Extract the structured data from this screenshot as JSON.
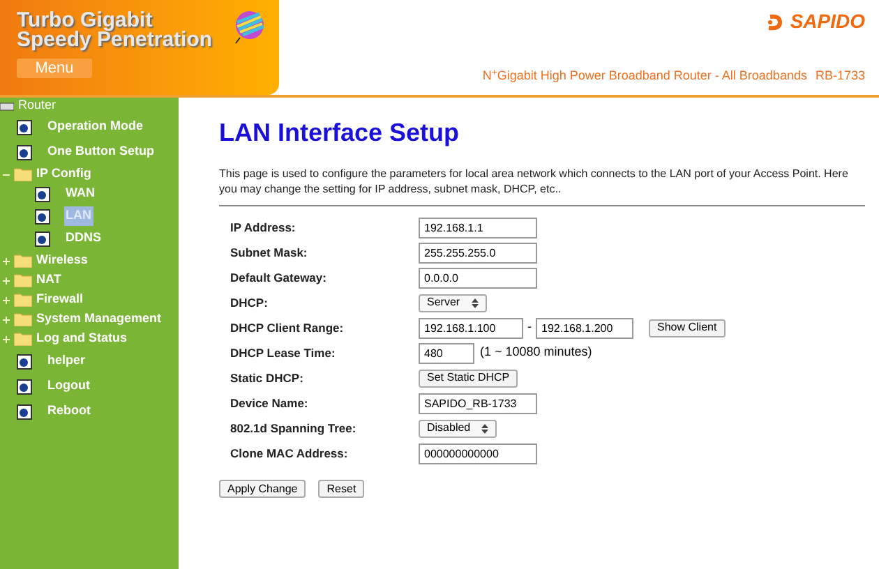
{
  "header": {
    "title_lines": [
      "Turbo Gigabit",
      "Speedy Penetration"
    ],
    "menu": "Menu",
    "brand": "SAPIDO",
    "tagline": {
      "sup": "+",
      "lead": "N",
      "text": "Gigabit High Power Broadband Router - All Broadbands",
      "model": "RB-1733"
    }
  },
  "sidebar": {
    "root": "Router",
    "items": [
      {
        "label": "Operation Mode",
        "kind": "page",
        "selected": false
      },
      {
        "label": "One Button Setup",
        "kind": "page",
        "selected": false
      },
      {
        "label": "IP Config",
        "kind": "folder",
        "expanded": true,
        "children": [
          {
            "label": "WAN",
            "kind": "page",
            "selected": false
          },
          {
            "label": "LAN",
            "kind": "page",
            "selected": true
          },
          {
            "label": "DDNS",
            "kind": "page",
            "selected": false
          }
        ]
      },
      {
        "label": "Wireless",
        "kind": "folder",
        "expanded": false
      },
      {
        "label": "NAT",
        "kind": "folder",
        "expanded": false
      },
      {
        "label": "Firewall",
        "kind": "folder",
        "expanded": false
      },
      {
        "label": "System Management",
        "kind": "folder",
        "expanded": false
      },
      {
        "label": "Log and Status",
        "kind": "folder",
        "expanded": false
      },
      {
        "label": "helper",
        "kind": "page",
        "selected": false
      },
      {
        "label": "Logout",
        "kind": "page",
        "selected": false
      },
      {
        "label": "Reboot",
        "kind": "page",
        "selected": false
      }
    ]
  },
  "page": {
    "title": "LAN Interface Setup",
    "description": "This page is used to configure the parameters for local area network which connects to the LAN port of your Access Point. Here you may change the setting for IP address, subnet mask, DHCP, etc..",
    "fields": [
      {
        "label": "IP Address:",
        "kind": "text",
        "value": "192.168.1.1"
      },
      {
        "label": "Subnet Mask:",
        "kind": "text",
        "value": "255.255.255.0"
      },
      {
        "label": "Default Gateway:",
        "kind": "text",
        "value": "0.0.0.0"
      },
      {
        "label": "DHCP:",
        "kind": "select",
        "value": "Server"
      },
      {
        "label": "DHCP Client Range:",
        "kind": "range",
        "value": "192.168.1.100",
        "separator": "-",
        "value_end": "192.168.1.200",
        "button": "Show Client"
      },
      {
        "label": "DHCP Lease Time:",
        "kind": "lease",
        "value": "480",
        "note": "(1 ~ 10080 minutes)"
      },
      {
        "label": "Static DHCP:",
        "kind": "button",
        "button": "Set Static DHCP"
      },
      {
        "label": "Device Name:",
        "kind": "text",
        "value": "SAPIDO_RB-1733"
      },
      {
        "label": "802.1d Spanning Tree:",
        "kind": "select",
        "value": "Disabled"
      },
      {
        "label": "Clone MAC Address:",
        "kind": "text",
        "value": "000000000000"
      }
    ],
    "buttons": [
      "Apply Change",
      "Reset"
    ]
  }
}
